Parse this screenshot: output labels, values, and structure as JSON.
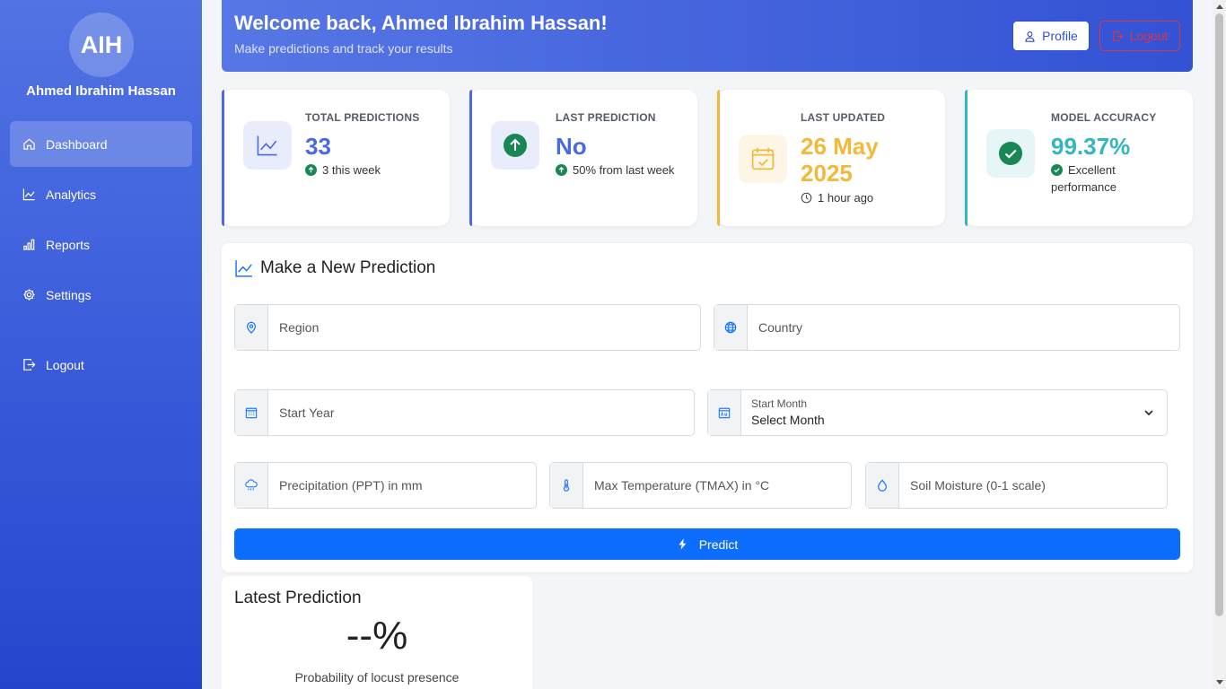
{
  "sidebar": {
    "initials": "AIH",
    "user_name": "Ahmed Ibrahim Hassan",
    "items": [
      {
        "label": "Dashboard",
        "icon": "home-icon",
        "active": true
      },
      {
        "label": "Analytics",
        "icon": "line-chart-icon"
      },
      {
        "label": "Reports",
        "icon": "bar-chart-icon"
      },
      {
        "label": "Settings",
        "icon": "gear-icon"
      },
      {
        "label": "Logout",
        "icon": "logout-icon"
      }
    ]
  },
  "header": {
    "welcome": "Welcome back, Ahmed Ibrahim Hassan!",
    "subtitle": "Make predictions and track your results",
    "profile_label": "Profile",
    "logout_label": "Logout"
  },
  "stats": [
    {
      "label": "TOTAL PREDICTIONS",
      "value": "33",
      "sub": "3 this week",
      "accent": "#4a6ae0"
    },
    {
      "label": "LAST PREDICTION",
      "value": "No",
      "sub": "50% from last week",
      "accent": "#4a6ae0"
    },
    {
      "label": "LAST UPDATED",
      "value_line1": "26 May",
      "value_line2": "2025",
      "sub": "1 hour ago",
      "accent": "#f2b93b"
    },
    {
      "label": "MODEL ACCURACY",
      "value": "99.37%",
      "sub_line1": "Excellent",
      "sub_line2": "performance",
      "accent": "#33b5c4"
    }
  ],
  "form": {
    "title": "Make a New Prediction",
    "region_placeholder": "Region",
    "country_placeholder": "Country",
    "start_year_placeholder": "Start Year",
    "start_month_label": "Start Month",
    "start_month_value": "Select Month",
    "ppt_placeholder": "Precipitation (PPT) in mm",
    "tmax_placeholder": "Max Temperature (TMAX) in °C",
    "soil_placeholder": "Soil Moisture (0-1 scale)",
    "predict_label": "Predict"
  },
  "latest": {
    "title": "Latest Prediction",
    "value": "--%",
    "caption": "Probability of locust presence"
  },
  "colors": {
    "primary": "#0d6efd",
    "sidebar_top": "#5173e3",
    "sidebar_bottom": "#2446cc",
    "success": "#198754",
    "danger": "#dc3545"
  }
}
